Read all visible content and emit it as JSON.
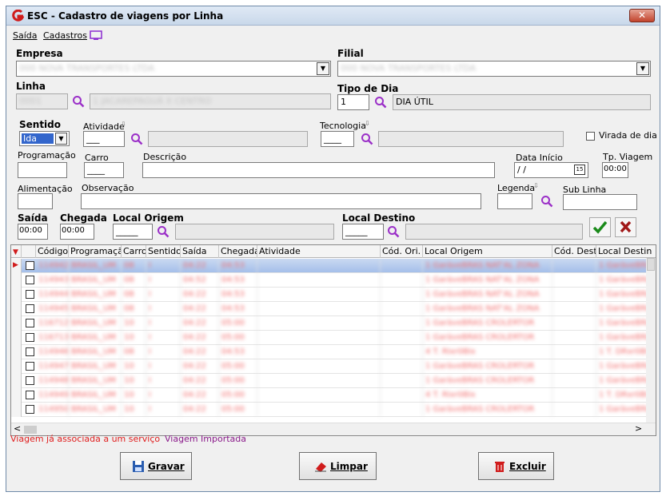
{
  "window": {
    "title": "ESC - Cadastro de viagens por Linha",
    "close_label": "✕"
  },
  "menu": {
    "items": [
      "Saída",
      "Cadastros"
    ]
  },
  "form": {
    "empresa_label": "Empresa",
    "empresa_value": "000 NOVA TRANSPORTES LTDA",
    "filial_label": "Filial",
    "filial_value": "000 NOVA TRANSPORTES LTDA",
    "linha_label": "Linha",
    "linha_code": "0001",
    "linha_desc": "1 JACAREPAGUÁ X CENTRO",
    "tipo_dia_label": "Tipo de Dia",
    "tipo_dia_code": "1",
    "tipo_dia_desc": "DIA ÚTIL",
    "sentido_label": "Sentido",
    "sentido_value": "Ida",
    "atividade_label": "Atividade",
    "atividade_value": "___",
    "tecnologia_label": "Tecnologia",
    "tecnologia_value": "____",
    "virada_label": "Virada de dia",
    "programacao_label": "Programação",
    "carro_label": "Carro",
    "carro_value": "____",
    "descricao_label": "Descrição",
    "data_inicio_label": "Data Início",
    "data_inicio_value": " / /",
    "tp_viagem_label": "Tp. Viagem",
    "tp_viagem_value": "00:00",
    "alimentacao_label": "Alimentação",
    "observacao_label": "Observação",
    "legenda_label": "Legenda",
    "sub_linha_label": "Sub Linha",
    "saida_label": "Saída",
    "saida_value": "00:00",
    "chegada_label": "Chegada",
    "chegada_value": "00:00",
    "local_origem_label": "Local Origem",
    "local_origem_value": "_____",
    "local_destino_label": "Local Destino",
    "local_destino_value": "_____"
  },
  "grid": {
    "columns": [
      "Código",
      "Programação",
      "Carro",
      "Sentido",
      "Saída",
      "Chegada",
      "Atividade",
      "Cód. Ori.",
      "Local Origem",
      "Cód. Dest.",
      "Local Destin"
    ],
    "rows": [
      [
        "114942",
        "BRASIL_UM",
        "08",
        "I",
        "04:22",
        "04:53",
        "",
        "",
        "1 GaràveBRAS NAT'AL ZONA",
        "",
        "1 GaràveBRA"
      ],
      [
        "114943",
        "BRASIL_UM",
        "08",
        "I",
        "04:52",
        "04:53",
        "",
        "",
        "1 GaràveBRAS NAT'AL ZONA",
        "",
        "1 GaràveBRA"
      ],
      [
        "114944",
        "BRASIL_UM",
        "08",
        "I",
        "04:22",
        "04:53",
        "",
        "",
        "1 GaràveBRAS NAT'AL ZONA",
        "",
        "1 GaràveBRA"
      ],
      [
        "114945",
        "BRASIL_UM",
        "08",
        "I",
        "04:22",
        "04:53",
        "",
        "",
        "1 GaràveBRAS NAT'AL ZONA",
        "",
        "1 GaràveBRA"
      ],
      [
        "116712",
        "BRASIL_UM",
        "10",
        "I",
        "04:22",
        "05:00",
        "",
        "",
        "1 GaràveBRAS CROLERTOR",
        "",
        "1 GaràveBRA"
      ],
      [
        "116713",
        "BRASIL_UM",
        "10",
        "I",
        "04:22",
        "05:00",
        "",
        "",
        "1 GaràveBRAS CROLERTOR",
        "",
        "1 GaràveBRA"
      ],
      [
        "114946",
        "BRASIL_UM",
        "08",
        "I",
        "04:22",
        "04:53",
        "",
        "",
        "4 T. RIxr0BIx",
        "",
        "1 T. DRxr0BI"
      ],
      [
        "114947",
        "BRASIL_UM",
        "10",
        "I",
        "04:22",
        "05:00",
        "",
        "",
        "1 GaràveBRAS CROLERTOR",
        "",
        "1 GaràveBRA"
      ],
      [
        "114948",
        "BRASIL_UM",
        "10",
        "I",
        "04:22",
        "05:00",
        "",
        "",
        "1 GaràveBRAS CROLERTOR",
        "",
        "1 GaràveBRA"
      ],
      [
        "114949",
        "BRASIL_UM",
        "10",
        "I",
        "04:22",
        "05:00",
        "",
        "",
        "4 T. RIxr0BIx",
        "",
        "1 T. DRxr0BI"
      ],
      [
        "114950",
        "BRASIL_UM",
        "10",
        "I",
        "04:22",
        "05:00",
        "",
        "",
        "1 GaràveBRAS CROLERTOR",
        "",
        "1 GaràveBRA"
      ]
    ]
  },
  "legend": {
    "assoc": "Viagem já associada a um serviço",
    "importada": "Viagem Importada",
    "assoc_color": "#e02020",
    "importada_color": "#8b1c8b"
  },
  "buttons": {
    "gravar": "Gravar",
    "limpar": "Limpar",
    "excluir": "Excluir"
  }
}
